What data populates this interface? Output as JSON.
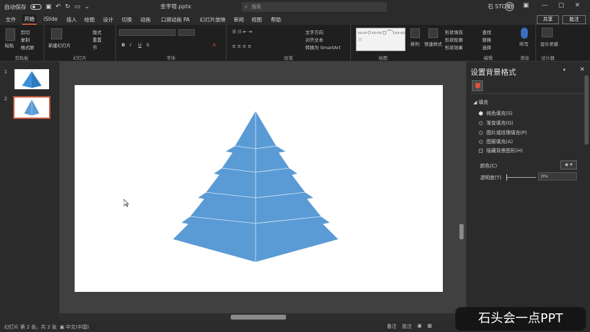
{
  "titlebar": {
    "autosave": "自动保存",
    "title": "金字塔.pptx",
    "search_placeholder": "搜索",
    "user": "石 STONY",
    "avatar": "石"
  },
  "menu": {
    "items": [
      "文件",
      "开始",
      "iSlide",
      "插入",
      "绘图",
      "设计",
      "切换",
      "动画",
      "口袋动画 PA",
      "幻灯片放映",
      "审阅",
      "视图",
      "帮助"
    ],
    "share": "共享",
    "comment": "批注"
  },
  "ribbon": {
    "groups": [
      {
        "label": "剪贴板",
        "buttons": [
          "粘贴",
          "剪切",
          "复制",
          "格式刷"
        ]
      },
      {
        "label": "幻灯片",
        "buttons": [
          "新建幻灯片",
          "版式",
          "重置",
          "节"
        ]
      },
      {
        "label": "字体",
        "buttons": [
          "B",
          "I",
          "U",
          "S",
          "A"
        ]
      },
      {
        "label": "段落",
        "buttons": [
          "文字方向",
          "对齐文本",
          "转换为 SmartArt"
        ]
      },
      {
        "label": "绘图",
        "buttons": [
          "排列",
          "快速样式",
          "形状填充",
          "形状轮廓",
          "形状效果"
        ]
      },
      {
        "label": "编辑",
        "buttons": [
          "查找",
          "替换",
          "选择"
        ]
      },
      {
        "label": "语音",
        "buttons": [
          "听写"
        ]
      },
      {
        "label": "设计器",
        "buttons": [
          "设计灵感"
        ]
      }
    ],
    "shapes_glyphs": "▭▱◇▭▭◻⌒\\▭▭▭◯△▯⌒↳∟↘{}☆"
  },
  "thumbnails": [
    {
      "number": "1",
      "selected": false
    },
    {
      "number": "2",
      "selected": true
    }
  ],
  "slide": {
    "pyramid_color": "#5b9bd5",
    "pyramid_edge": "#ffffff"
  },
  "pane": {
    "title": "设置背景格式",
    "section": "填充",
    "options": [
      {
        "label": "纯色填充(S)",
        "type": "radio",
        "checked": true
      },
      {
        "label": "渐变填充(G)",
        "type": "radio",
        "checked": false
      },
      {
        "label": "图片或纹理填充(P)",
        "type": "radio",
        "checked": false
      },
      {
        "label": "图案填充(A)",
        "type": "radio",
        "checked": false
      },
      {
        "label": "隐藏背景图形(H)",
        "type": "checkbox",
        "checked": false
      }
    ],
    "color_label": "颜色(C)",
    "transparency_label": "透明度(T)",
    "transparency_value": "0%"
  },
  "status": {
    "left": "幻灯片 第 2 张，共 2 张",
    "lang": "中文(中国)",
    "right": [
      "备注",
      "批注"
    ]
  },
  "watermark": "石头会一点PPT"
}
